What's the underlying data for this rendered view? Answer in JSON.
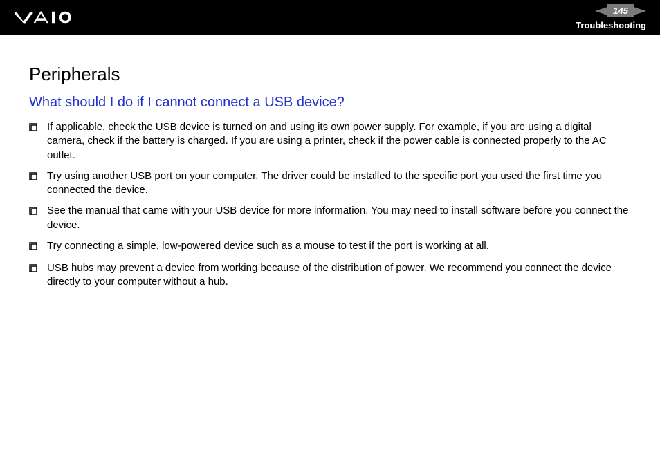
{
  "header": {
    "page_number": "145",
    "section": "Troubleshooting"
  },
  "content": {
    "heading": "Peripherals",
    "subheading": "What should I do if I cannot connect a USB device?",
    "bullets": [
      "If applicable, check the USB device is turned on and using its own power supply. For example, if you are using a digital camera, check if the battery is charged. If you are using a printer, check if the power cable is connected properly to the AC outlet.",
      "Try using another USB port on your computer. The driver could be installed to the specific port you used the first time you connected the device.",
      "See the manual that came with your USB device for more information. You may need to install software before you connect the device.",
      "Try connecting a simple, low-powered device such as a mouse to test if the port is working at all.",
      "USB hubs may prevent a device from working because of the distribution of power. We recommend you connect the device directly to your computer without a hub."
    ]
  }
}
